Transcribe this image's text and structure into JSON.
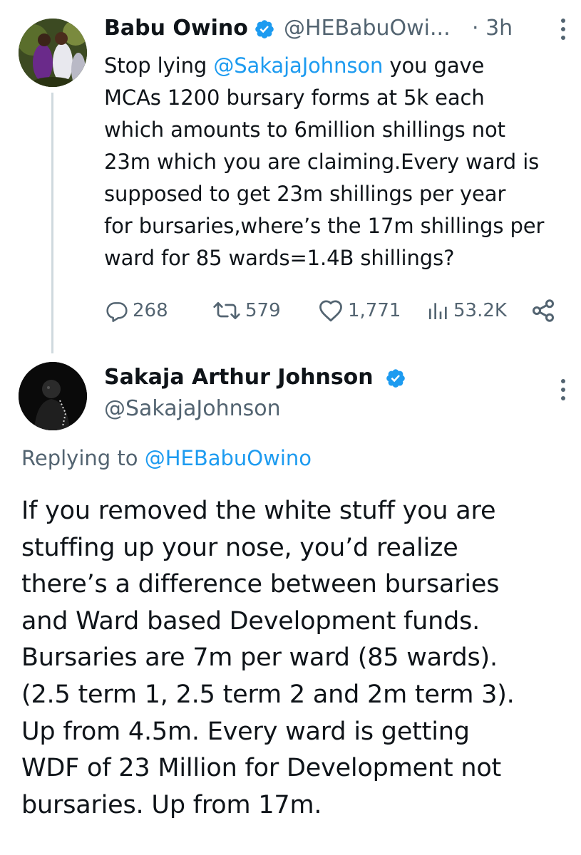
{
  "tweet": {
    "author_name": "Babu Owino",
    "author_handle": "@HEBabuOwi...",
    "time": "· 3h",
    "text_before_mention": "Stop lying ",
    "mention": "@SakajaJohnson",
    "text_after_mention": " you gave\nMCAs 1200 bursary forms at 5k each\nwhich amounts to 6million shillings not\n23m which you are claiming.Every ward is\nsupposed to get 23m shillings per year\nfor bursaries,where’s the 17m shillings per\nward for 85 wards=1.4B shillings?",
    "metrics": {
      "replies": "268",
      "retweets": "579",
      "likes": "1,771",
      "views": "53.2K"
    }
  },
  "reply": {
    "author_name": "Sakaja Arthur Johnson",
    "author_handle": "@SakajaJohnson",
    "replying_prefix": "Replying to ",
    "replying_to": "@HEBabuOwino",
    "text": "If you removed the white stuff you are\nstuffing up your nose, you’d realize\nthere’s a difference between bursaries\nand Ward based Development funds.\nBursaries are 7m per ward (85 wards).\n(2.5 term 1, 2.5 term 2 and 2m term 3).\nUp from 4.5m. Every ward is getting\nWDF of 23 Million for Development not\nbursaries. Up from 17m."
  },
  "icons": {
    "verified": "verified-badge-icon",
    "more": "more-options-icon",
    "reply": "reply-icon",
    "retweet": "retweet-icon",
    "like": "like-icon",
    "views": "views-icon",
    "share": "share-icon"
  },
  "colors": {
    "accent": "#1d9bf0",
    "secondary_text": "#536471",
    "primary_text": "#0f1419",
    "thread_line": "#cfd9de"
  }
}
